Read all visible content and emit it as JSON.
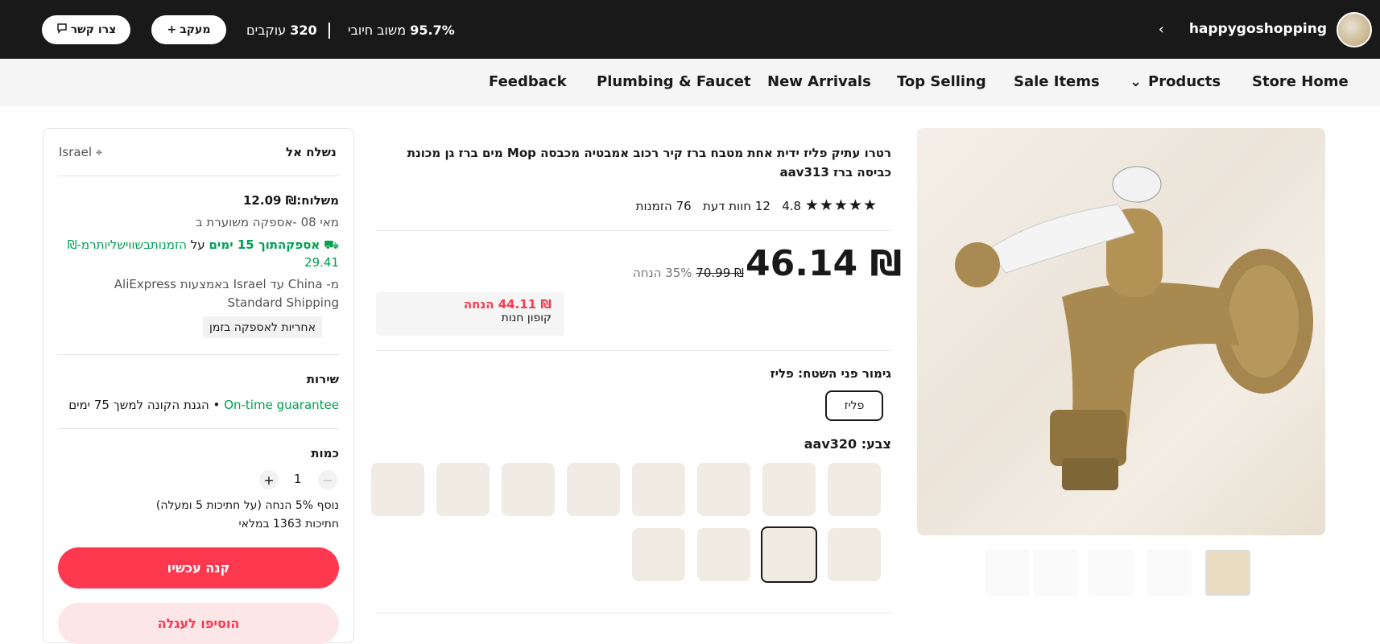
{
  "header": {
    "store_name": "happygoshopping",
    "feedback_value": "95.7%",
    "feedback_label": "משוב חיובי",
    "followers_value": "320",
    "followers_label": "עוקבים",
    "follow_label": "מעקב",
    "contact_label": "צרו קשר"
  },
  "nav": {
    "items": [
      "Store Home",
      "Products",
      "Sale Items",
      "Top Selling",
      "New Arrivals",
      "Plumbing & Faucet",
      "Feedback"
    ]
  },
  "product": {
    "title": "רטרו עתיק פליז ידית אחת מטבח ברז קיר רכוב אמבטיה מכבסה Mop מים ברז גן מכונת כביסה ברז aav313",
    "rating": "4.8",
    "reviews": "12 חוות דעת",
    "orders": "76 הזמנות",
    "price": "₪ 46.14",
    "old_price": "₪ 70.99",
    "discount": "35% הנחה",
    "coupon_value": "₪ 44.11 הנחה",
    "coupon_label": "קופון חנות",
    "finish_label": "גימור פני השטח: פליז",
    "finish_option": "פליז",
    "color_label": "צבע: aav320"
  },
  "panel": {
    "ship_to_label": "נשלח אל",
    "ship_to_value": "Israel",
    "shipping_cost": "משלוח:₪ 12.09",
    "delivery_date": "מאי 08 -אספקה משוערת ב",
    "fast_delivery": "אספקהתוך 15 ימים",
    "fast_delivery_on": "על",
    "fast_delivery_cond": "הזמנותבשווישליותרמ-₪ 29.41",
    "route": "מ- China עד Israel באמצעות AliExpress Standard Shipping",
    "ontime_tag": "אחריות לאספקה בזמן",
    "service_title": "שירות",
    "service_green": "On-time guarantee",
    "service_rest": "• הגנת הקונה למשך 75 ימים",
    "qty_title": "כמות",
    "qty_value": "1",
    "qty_note": "נוסף 5% הנחה (על חתיכות 5 ומעלה)",
    "qty_stock": "חתיכות 1363 במלאי",
    "buy_label": "קנה עכשיו",
    "cart_label": "הוסיפו לעגלה"
  },
  "colors": {
    "accent": "#fd384f",
    "dark": "#191919",
    "green": "#00a050"
  }
}
